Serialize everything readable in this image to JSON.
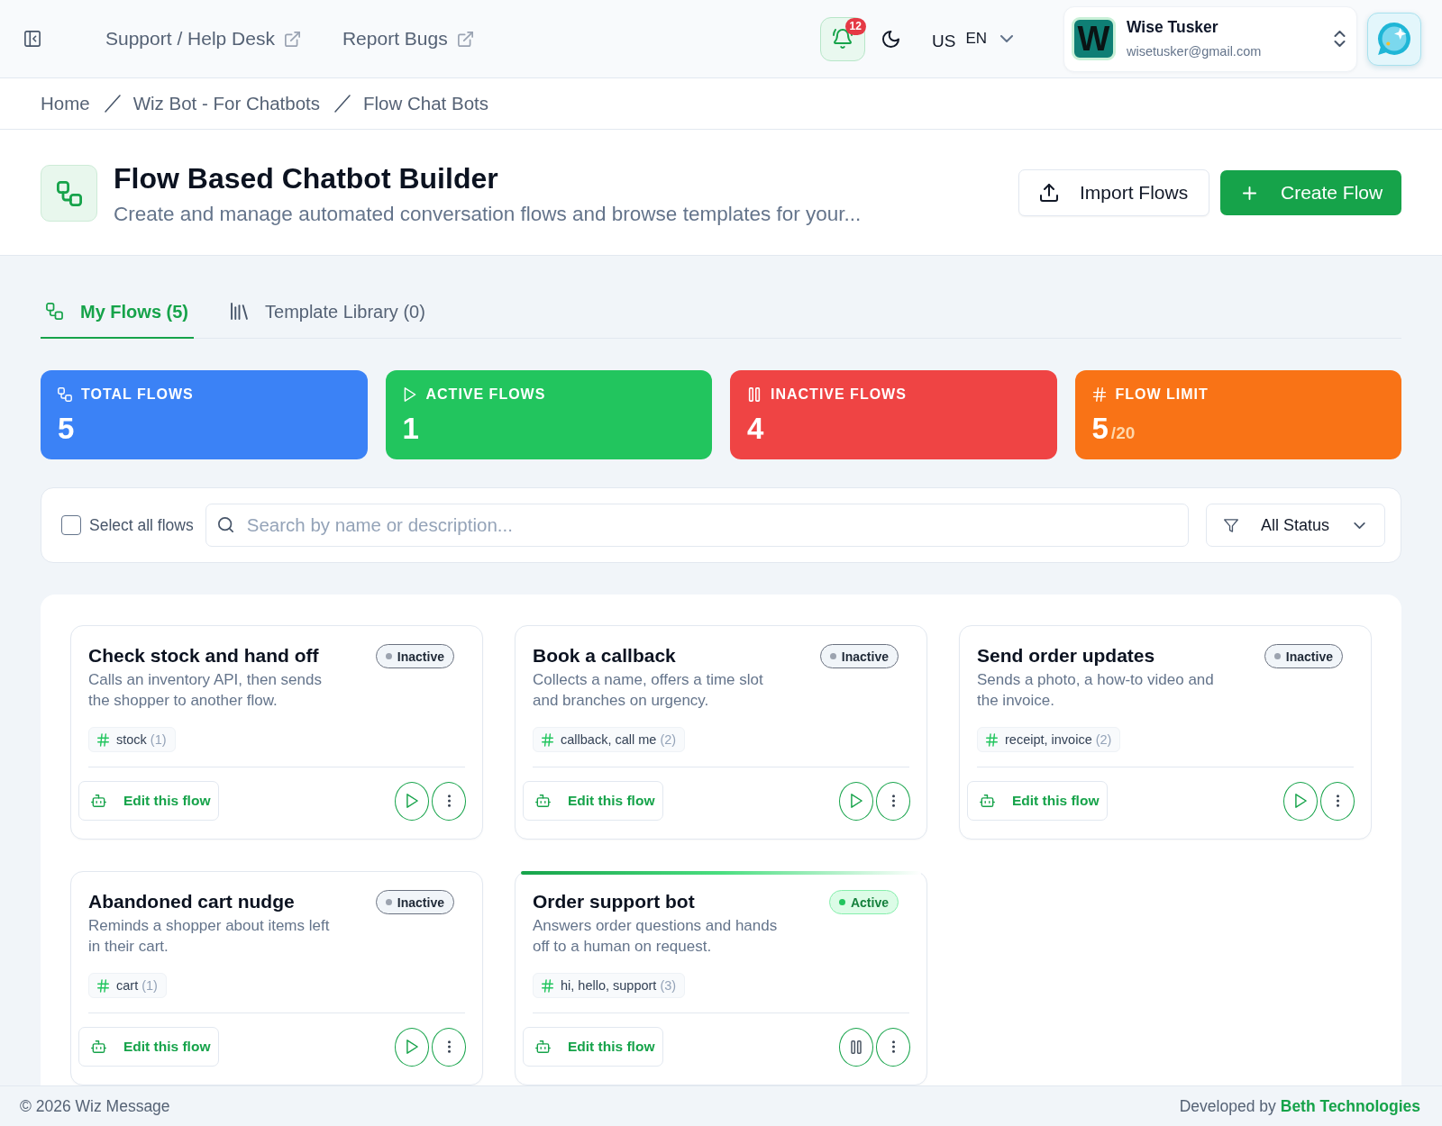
{
  "header": {
    "links": [
      {
        "label": "Support / Help Desk"
      },
      {
        "label": "Report Bugs"
      }
    ],
    "notifications": {
      "count": "12"
    },
    "language": {
      "country": "US",
      "code": "EN"
    },
    "user": {
      "initial": "W",
      "name": "Wise Tusker",
      "email": "wisetusker@gmail.com"
    }
  },
  "breadcrumb": [
    {
      "label": "Home"
    },
    {
      "label": "Wiz Bot - For Chatbots"
    },
    {
      "label": "Flow Chat Bots"
    }
  ],
  "page": {
    "title": "Flow Based Chatbot Builder",
    "subtitle": "Create and manage automated conversation flows and browse templates for your...",
    "actions": [
      {
        "label": "Import Flows",
        "kind": "import"
      },
      {
        "label": "Create Flow",
        "kind": "create"
      }
    ]
  },
  "tabs": [
    {
      "label": "My Flows (5)",
      "kind": "flows",
      "selected": true
    },
    {
      "label": "Template Library (0)",
      "kind": "library",
      "selected": false
    }
  ],
  "stats": [
    {
      "kind": "total",
      "label": "TOTAL FLOWS",
      "value": "5",
      "color": "#3b82f6"
    },
    {
      "kind": "active",
      "label": "ACTIVE FLOWS",
      "value": "1",
      "color": "#22c55e"
    },
    {
      "kind": "inactive",
      "label": "INACTIVE FLOWS",
      "value": "4",
      "color": "#ef4444"
    },
    {
      "kind": "limit",
      "label": "FLOW LIMIT",
      "value": "5",
      "max": "/20",
      "color": "#f97316"
    }
  ],
  "filters": {
    "select_all": {
      "label": "Select all flows",
      "checked": false
    },
    "search": {
      "placeholder": "Search by name or description..."
    },
    "status": {
      "value": "All Status"
    }
  },
  "flows": [
    {
      "name": "Check stock and hand off",
      "description": "Calls an inventory API, then sends the shopper to another flow.",
      "status": "Inactive",
      "active": false,
      "keywords": "stock",
      "count": "(1)",
      "edit_label": "Edit this flow"
    },
    {
      "name": "Book a callback",
      "description": "Collects a name, offers a time slot and branches on urgency.",
      "status": "Inactive",
      "active": false,
      "keywords": "callback, call me",
      "count": "(2)",
      "edit_label": "Edit this flow"
    },
    {
      "name": "Send order updates",
      "description": "Sends a photo, a how-to video and the invoice.",
      "status": "Inactive",
      "active": false,
      "keywords": "receipt, invoice",
      "count": "(2)",
      "edit_label": "Edit this flow"
    },
    {
      "name": "Abandoned cart nudge",
      "description": "Reminds a shopper about items left in their cart.",
      "status": "Inactive",
      "active": false,
      "keywords": "cart",
      "count": "(1)",
      "edit_label": "Edit this flow"
    },
    {
      "name": "Order support bot",
      "description": "Answers order questions and hands off to a human on request.",
      "status": "Active",
      "active": true,
      "keywords": "hi, hello, support",
      "count": "(3)",
      "edit_label": "Edit this flow"
    }
  ],
  "footer": {
    "copyright": "© 2026 Wiz Message",
    "credit": "Developed by",
    "company": "Beth Technologies"
  }
}
